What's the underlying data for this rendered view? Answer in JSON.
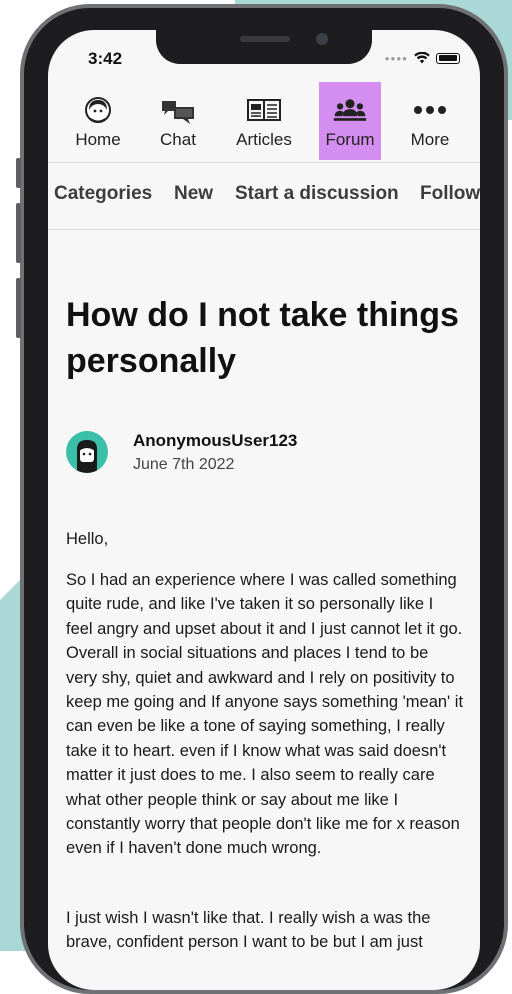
{
  "status_bar": {
    "time": "3:42"
  },
  "nav": {
    "items": [
      {
        "label": "Home",
        "icon": "home-avatar-icon"
      },
      {
        "label": "Chat",
        "icon": "chat-bubbles-icon"
      },
      {
        "label": "Articles",
        "icon": "articles-icon"
      },
      {
        "label": "Forum",
        "icon": "forum-people-icon",
        "active": true
      },
      {
        "label": "More",
        "icon": "more-dots-icon"
      }
    ],
    "active_color": "#d48ef0"
  },
  "subnav": {
    "items": [
      "Categories",
      "New",
      "Start a discussion",
      "Following"
    ]
  },
  "post": {
    "title": "How do I not take things personally",
    "author": "AnonymousUser123",
    "date": "June 7th 2022",
    "avatar_color": "#3cbfa9",
    "paragraphs": [
      "Hello,",
      "So I had an experience where I was called something quite rude, and like I've taken it so personally like I feel angry and upset about it and I just cannot let it go. Overall in social situations and places I tend to be very shy, quiet and awkward and I rely on positivity to keep me going and If anyone says something 'mean' it can even be like a tone of saying something, I really take it to heart. even if I know what was said doesn't matter it just does to me. I also seem to really care what other people think or say about me like I constantly worry that people don't like me for x reason even if I haven't done much wrong.",
      "I just wish I wasn't like that. I really wish a was the brave, confident person I want to be but I am just"
    ]
  },
  "colors": {
    "background_accent": "#a9d8d7",
    "phone_frame": "#1d1d1f"
  }
}
